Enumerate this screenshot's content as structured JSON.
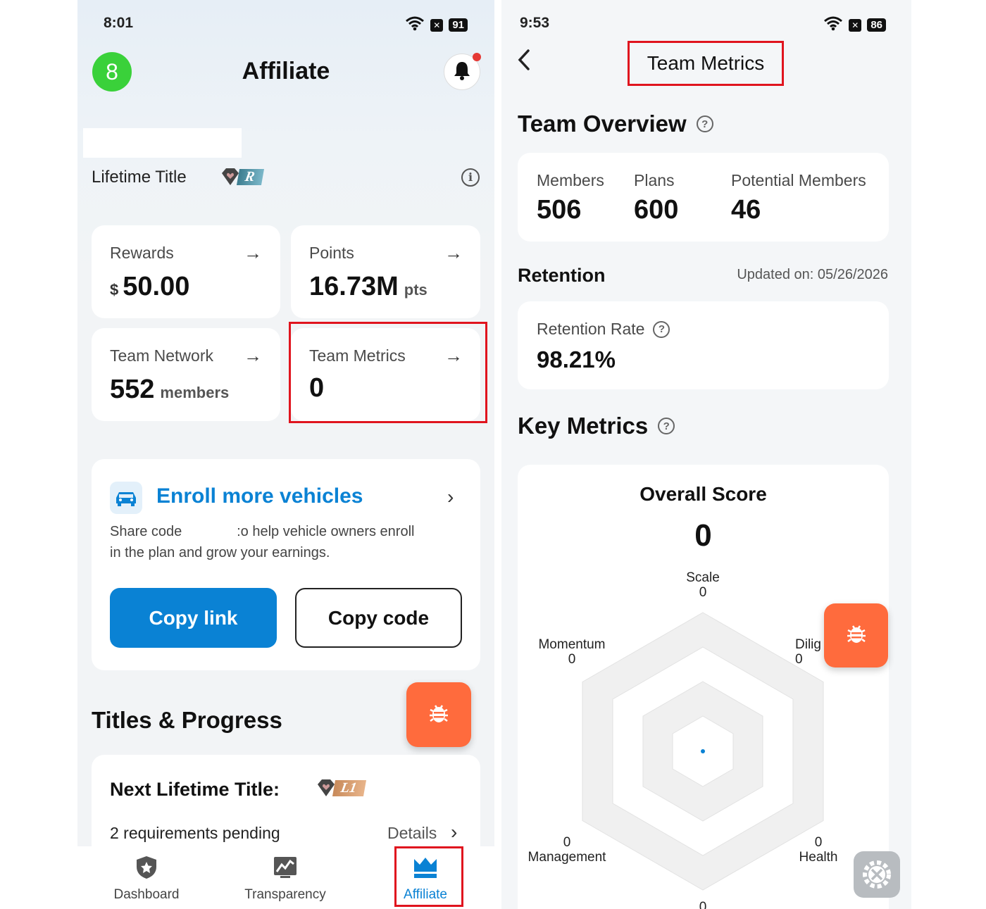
{
  "left": {
    "status": {
      "time": "8:01",
      "battery": "91"
    },
    "header": {
      "avatar": "8",
      "title": "Affiliate"
    },
    "lifetime_title": {
      "label": "Lifetime Title",
      "badge": "R"
    },
    "cards": {
      "rewards": {
        "label": "Rewards",
        "currency": "$",
        "value": "50.00"
      },
      "points": {
        "label": "Points",
        "value": "16.73M",
        "unit": "pts"
      },
      "team_network": {
        "label": "Team Network",
        "value": "552",
        "unit": "members"
      },
      "team_metrics": {
        "label": "Team Metrics",
        "value": "0"
      }
    },
    "enroll": {
      "title": "Enroll more vehicles",
      "desc_line1": "Share code              :o help vehicle owners enroll",
      "desc_line2": "in the plan and grow your earnings.",
      "copy_link": "Copy link",
      "copy_code": "Copy code"
    },
    "titles_progress": {
      "heading": "Titles & Progress",
      "next_label": "Next Lifetime Title:",
      "next_badge": "L1",
      "pending": "2 requirements pending",
      "details": "Details"
    },
    "nav": {
      "dashboard": "Dashboard",
      "transparency": "Transparency",
      "affiliate": "Affiliate"
    }
  },
  "right": {
    "status": {
      "time": "9:53",
      "battery": "86"
    },
    "header": {
      "title": "Team Metrics"
    },
    "overview": {
      "heading": "Team Overview",
      "members_label": "Members",
      "members_value": "506",
      "plans_label": "Plans",
      "plans_value": "600",
      "potential_label": "Potential Members",
      "potential_value": "46"
    },
    "retention": {
      "heading": "Retention",
      "updated": "Updated on: 05/26/2026",
      "rate_label": "Retention Rate",
      "rate_value": "98.21%"
    },
    "key_metrics": {
      "heading": "Key Metrics",
      "overall_label": "Overall Score",
      "overall_value": "0",
      "axes": {
        "scale": {
          "label": "Scale",
          "value": "0"
        },
        "diligence": {
          "label": "Dilig",
          "value": "0"
        },
        "health": {
          "label": "Health",
          "value": "0"
        },
        "bottom": {
          "value": "0"
        },
        "management": {
          "label": "Management",
          "value": "0"
        },
        "momentum": {
          "label": "Momentum",
          "value": "0"
        }
      }
    }
  },
  "colors": {
    "accent": "#0a82d4",
    "highlight": "#e0141e",
    "fab": "#ff6b3d",
    "avatar": "#3ad13a"
  }
}
